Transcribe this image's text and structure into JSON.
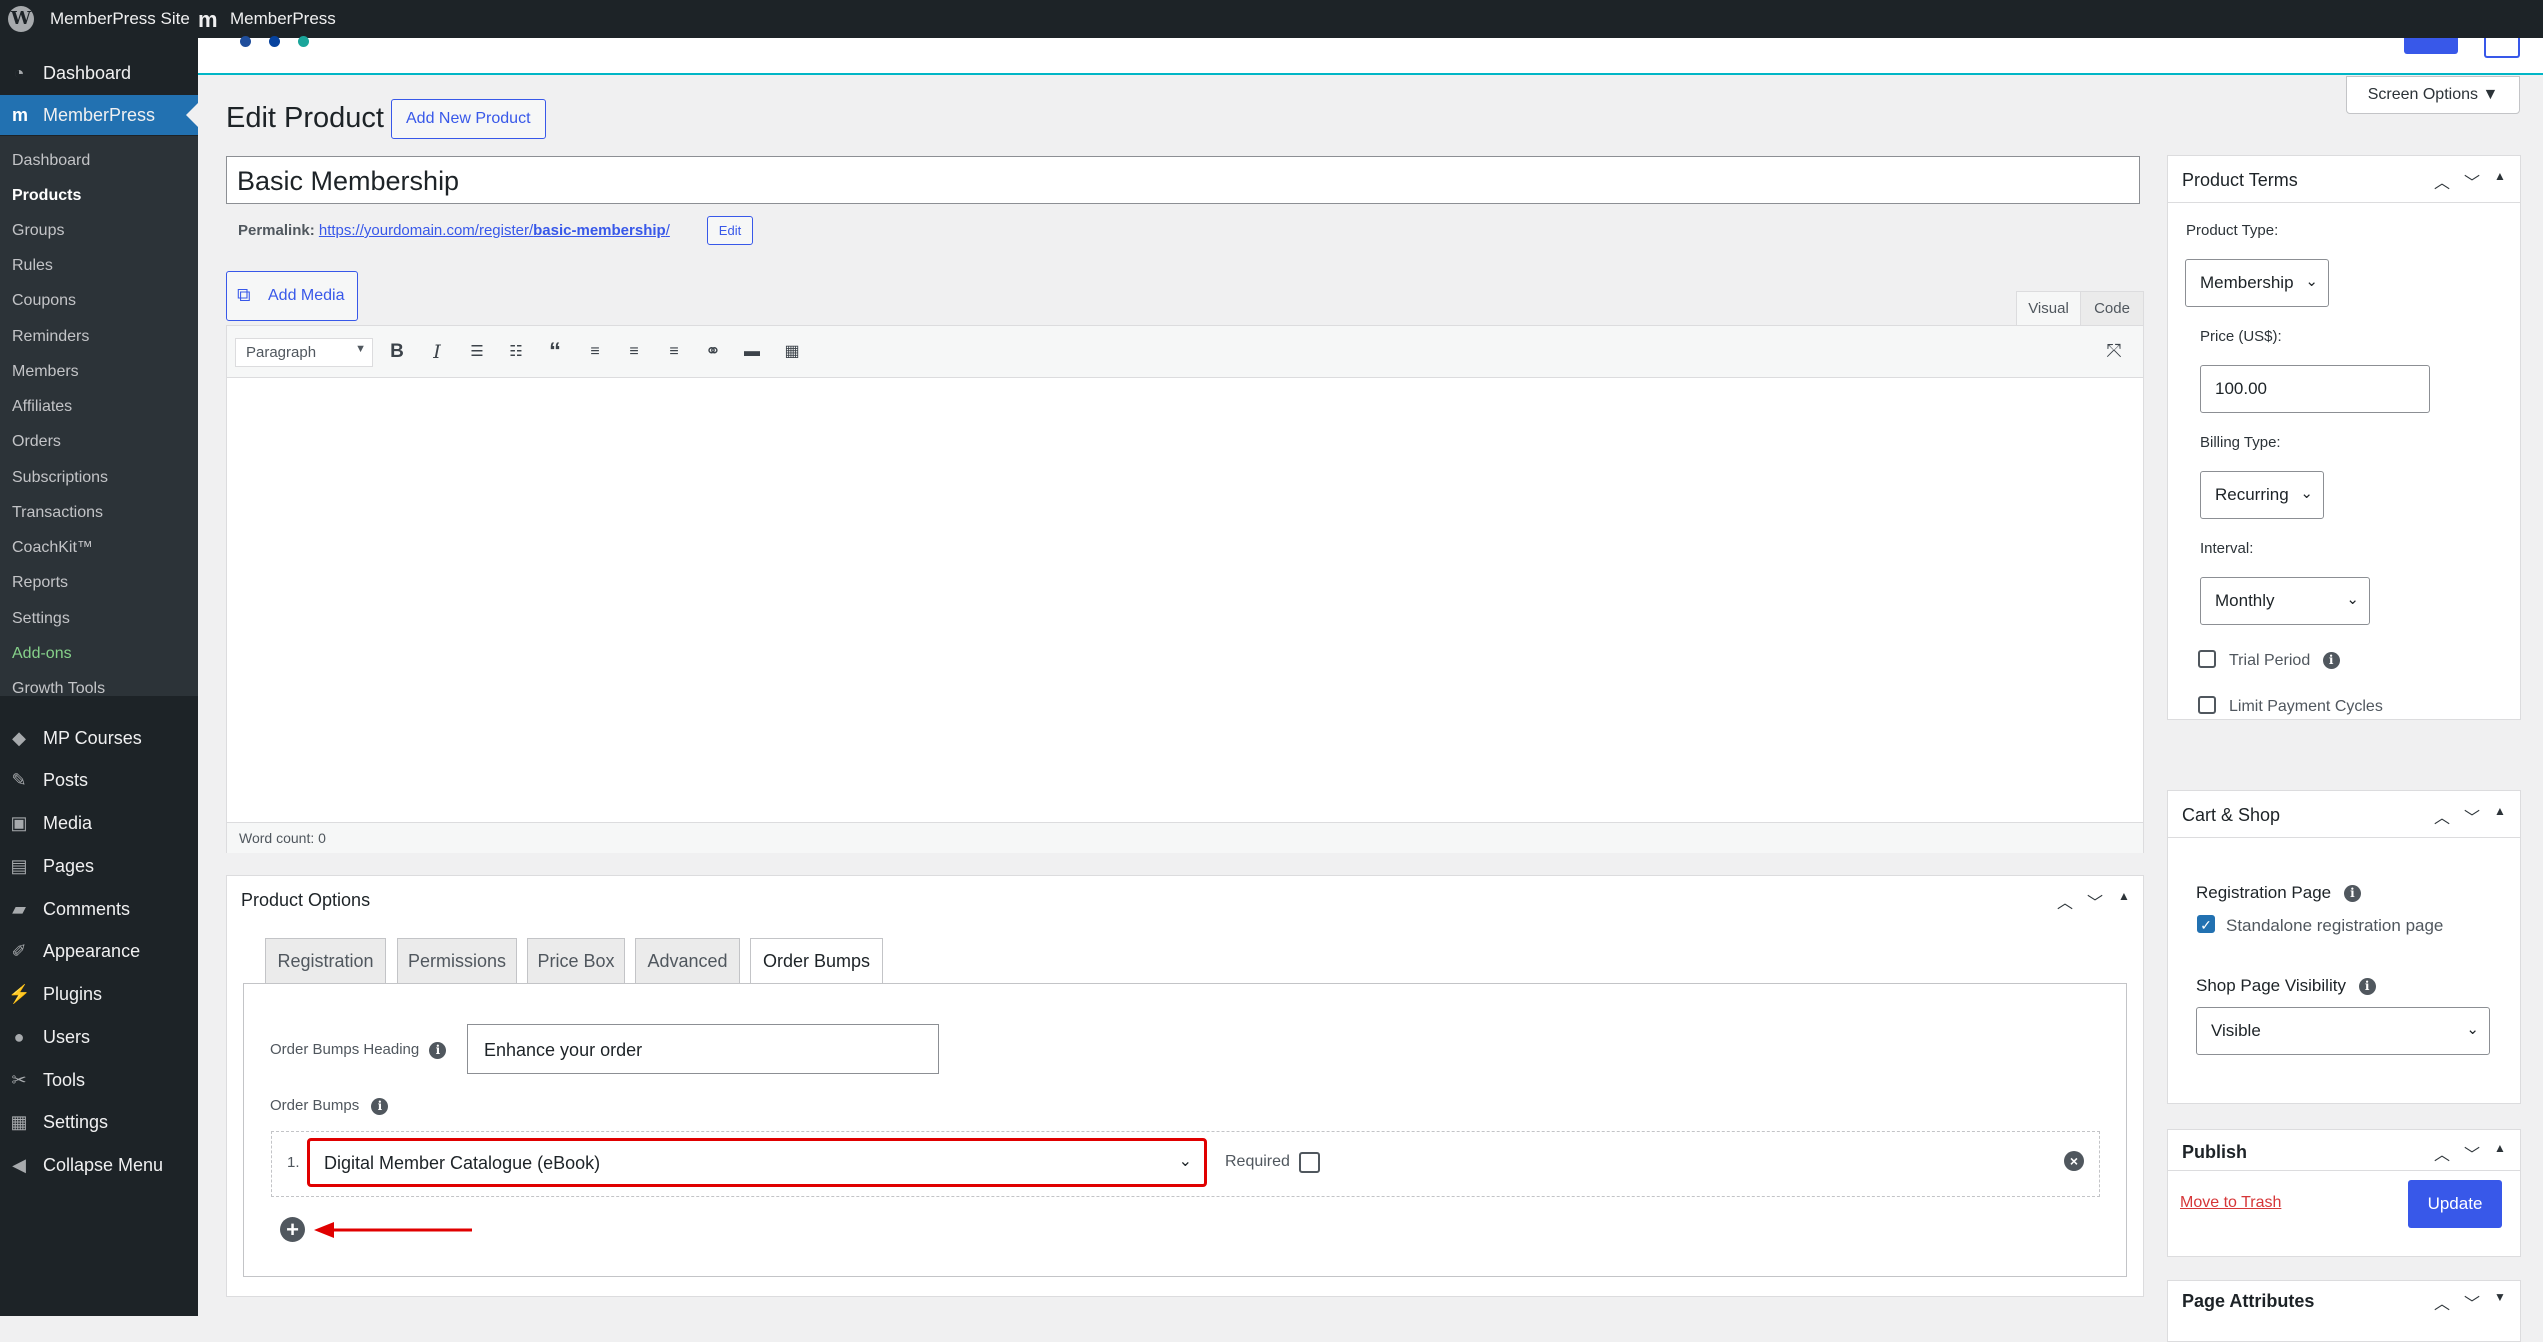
{
  "adminbar": {
    "site_name": "MemberPress Site",
    "plugin_name": "MemberPress"
  },
  "sidebar": {
    "top_items": [
      {
        "label": "Dashboard",
        "icon": "dashboard-icon"
      },
      {
        "label": "MemberPress",
        "icon": "memberpress-icon"
      }
    ],
    "sub_items": [
      "Dashboard",
      "Products",
      "Groups",
      "Rules",
      "Coupons",
      "Reminders",
      "Members",
      "Affiliates",
      "Orders",
      "Subscriptions",
      "Transactions",
      "CoachKit™",
      "Reports",
      "Settings",
      "Add-ons",
      "Growth Tools"
    ],
    "bottom_items": [
      {
        "label": "MP Courses",
        "icon": "courses-icon"
      },
      {
        "label": "Posts",
        "icon": "pin-icon"
      },
      {
        "label": "Media",
        "icon": "media-icon"
      },
      {
        "label": "Pages",
        "icon": "page-icon"
      },
      {
        "label": "Comments",
        "icon": "comment-icon"
      },
      {
        "label": "Appearance",
        "icon": "brush-icon"
      },
      {
        "label": "Plugins",
        "icon": "plug-icon"
      },
      {
        "label": "Users",
        "icon": "user-icon"
      },
      {
        "label": "Tools",
        "icon": "wrench-icon"
      },
      {
        "label": "Settings",
        "icon": "settings-icon"
      },
      {
        "label": "Collapse Menu",
        "icon": "collapse-icon"
      }
    ]
  },
  "header": {
    "screen_options": "Screen Options ▼",
    "page_title": "Edit Product",
    "add_new_label": "Add New Product"
  },
  "product": {
    "title": "Basic Membership",
    "permalink_label": "Permalink:",
    "permalink_base": "https://yourdomain.com/register/",
    "permalink_slug": "basic-membership",
    "permalink_end": "/",
    "permalink_edit": "Edit"
  },
  "editor": {
    "add_media": "Add Media",
    "tab_visual": "Visual",
    "tab_code": "Code",
    "format": "Paragraph",
    "word_count": "Word count: 0"
  },
  "product_options": {
    "title": "Product Options",
    "tabs": [
      "Registration",
      "Permissions",
      "Price Box",
      "Advanced",
      "Order Bumps"
    ],
    "active_tab": "Order Bumps",
    "heading_label": "Order Bumps Heading",
    "heading_value": "Enhance your order",
    "bumps_label": "Order Bumps",
    "bump_number": "1.",
    "bump_selected": "Digital Member Catalogue (eBook)",
    "required_label": "Required",
    "required_checked": false
  },
  "product_terms": {
    "title": "Product Terms",
    "type_label": "Product Type:",
    "type_value": "Membership",
    "price_label": "Price (US$):",
    "price_value": "100.00",
    "billing_label": "Billing Type:",
    "billing_value": "Recurring",
    "interval_label": "Interval:",
    "interval_value": "Monthly",
    "trial_label": "Trial Period",
    "limit_label": "Limit Payment Cycles"
  },
  "cart_shop": {
    "title": "Cart & Shop",
    "registration_label": "Registration Page",
    "standalone_label": "Standalone registration page",
    "standalone_checked": true,
    "visibility_label": "Shop Page Visibility",
    "visibility_value": "Visible"
  },
  "publish": {
    "title": "Publish",
    "trash_label": "Move to Trash",
    "update_label": "Update"
  },
  "page_attributes": {
    "title": "Page Attributes"
  },
  "colors": {
    "accent": "#3858e9",
    "highlight_border": "#e00000",
    "arrow": "#e00000",
    "sidebar_bg": "#1d2327",
    "active_menu": "#2271b1"
  }
}
